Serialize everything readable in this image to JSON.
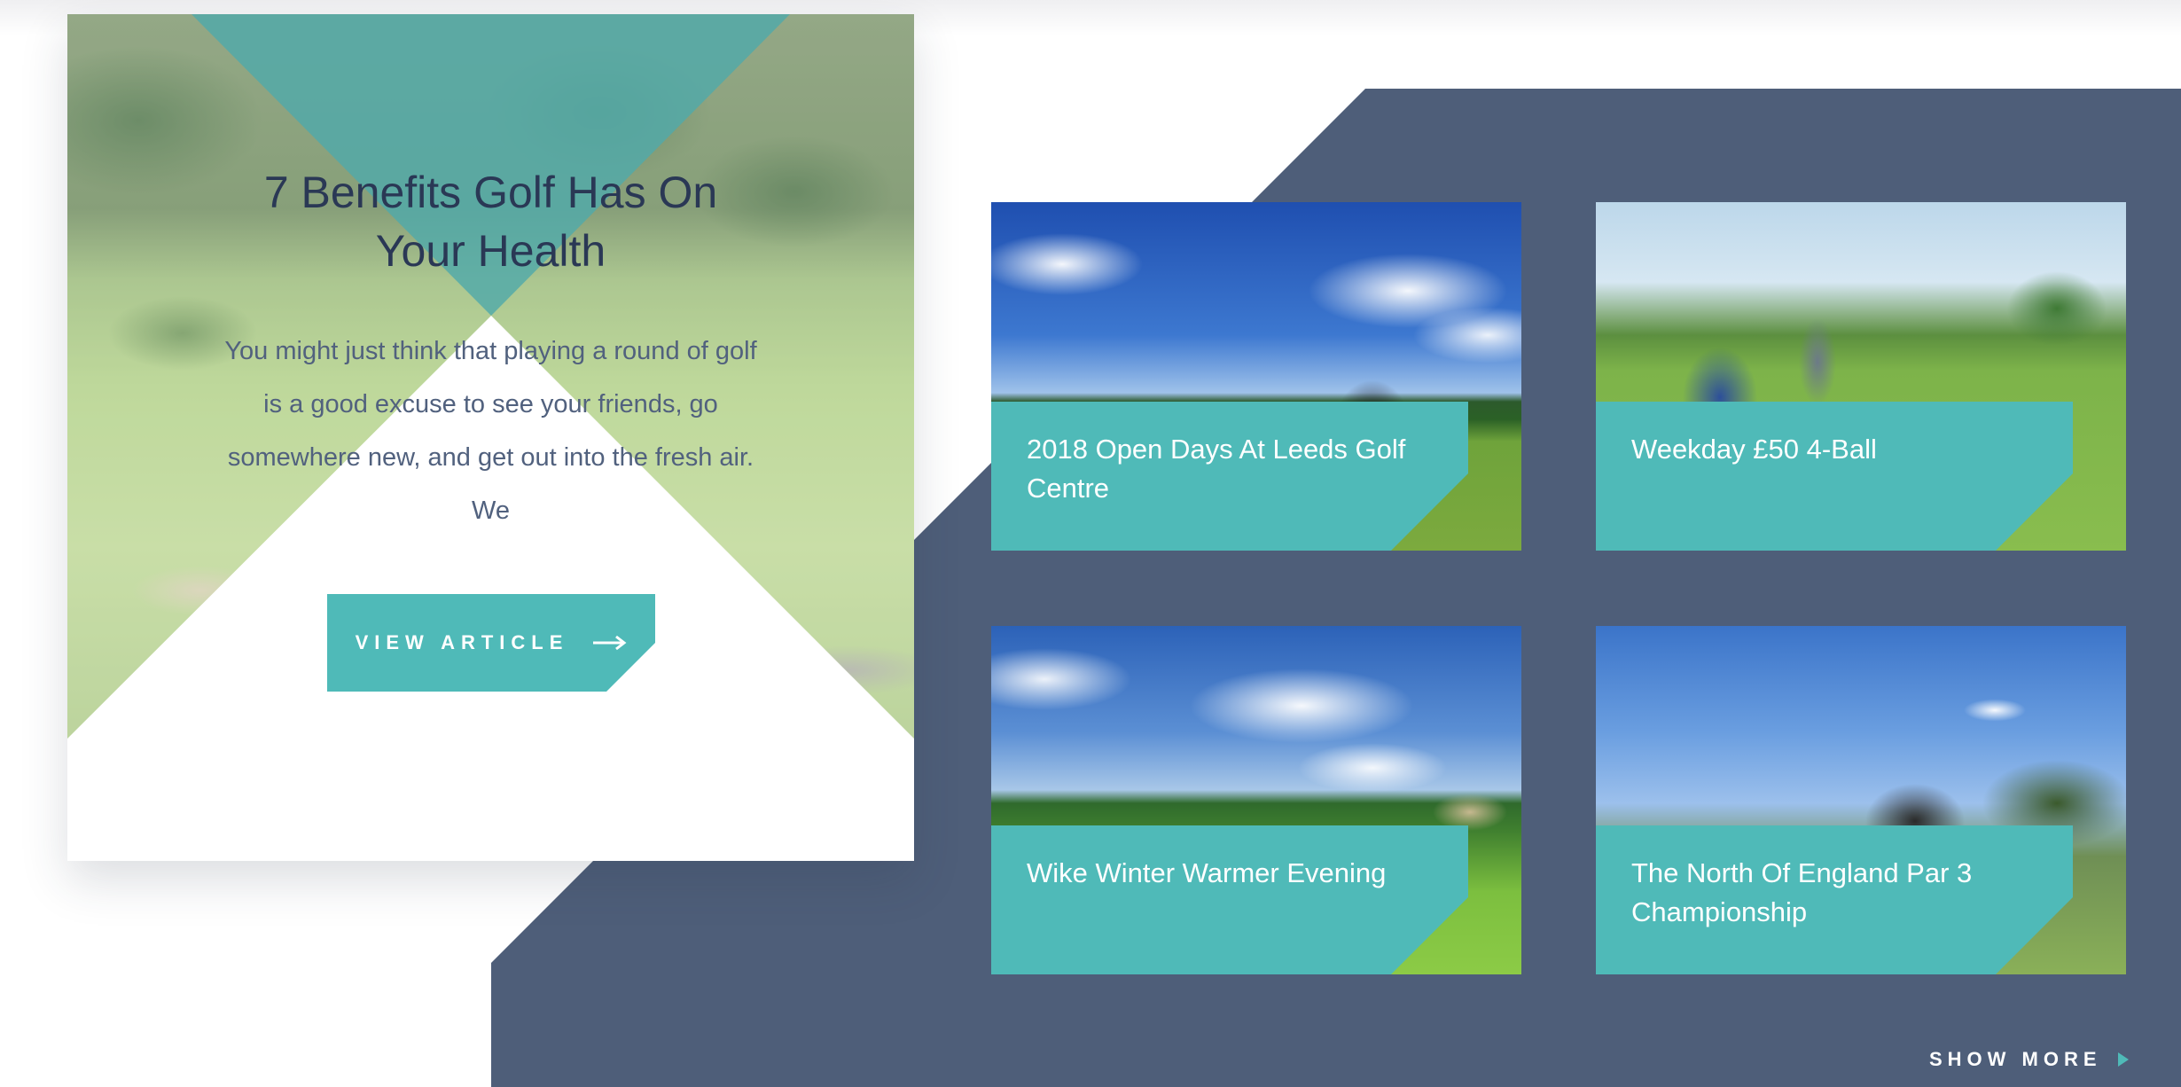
{
  "colors": {
    "teal": "#4fbab8",
    "slate": "#4e5e79",
    "title_text": "#2a3855",
    "body_text": "#51617e"
  },
  "featured": {
    "title": "7 Benefits Golf Has On Your Health",
    "excerpt": "You might just think that playing a round of golf is a good excuse to see your friends, go somewhere new, and get out into the fresh air. We",
    "button_label": "VIEW ARTICLE",
    "button_icon": "long-arrow-right-icon"
  },
  "cards": [
    {
      "title": "2018 Open Days At Leeds Golf Centre"
    },
    {
      "title": "Weekday £50 4-Ball"
    },
    {
      "title": "Wike Winter Warmer Evening"
    },
    {
      "title": "The North Of England Par 3 Championship"
    }
  ],
  "show_more": {
    "label": "SHOW MORE",
    "icon": "triangle-right-icon"
  }
}
